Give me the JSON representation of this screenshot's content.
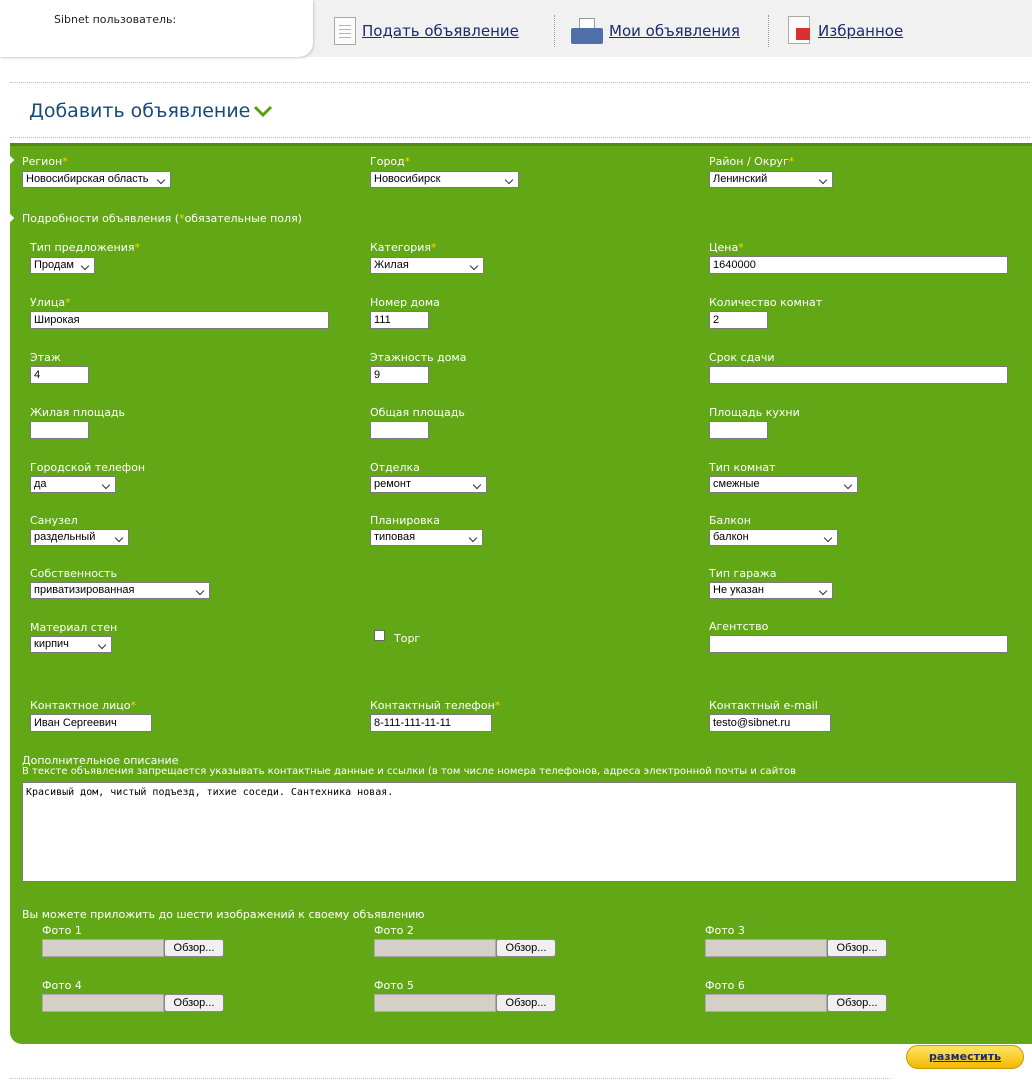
{
  "header": {
    "user_label": "Sibnet пользователь:",
    "nav": [
      {
        "label": "Подать объявление",
        "icon": "document-icon"
      },
      {
        "label": "Мои объявления",
        "icon": "inbox-icon"
      },
      {
        "label": "Избранное",
        "icon": "favorites-icon"
      }
    ]
  },
  "page_title": "Добавить объявление",
  "location": {
    "region_label": "Регион",
    "region_value": "Новосибирская область",
    "city_label": "Город",
    "city_value": "Новосибирск",
    "district_label": "Район / Округ",
    "district_value": "Ленинский"
  },
  "details_heading": {
    "pre": "Подробности объявления (",
    "star": "*",
    "post": "обязательные поля)"
  },
  "fields": {
    "offer_type_label": "Тип предложения",
    "offer_type_value": "Продам",
    "category_label": "Категория",
    "category_value": "Жилая",
    "price_label": "Цена",
    "price_value": "1640000",
    "street_label": "Улица",
    "street_value": "Широкая",
    "house_label": "Номер дома",
    "house_value": "111",
    "rooms_label": "Количество комнат",
    "rooms_value": "2",
    "floor_label": "Этаж",
    "floor_value": "4",
    "floors_label": "Этажность дома",
    "floors_value": "9",
    "deadline_label": "Срок сдачи",
    "deadline_value": "",
    "living_area_label": "Жилая площадь",
    "living_area_value": "",
    "total_area_label": "Общая площадь",
    "total_area_value": "",
    "kitchen_area_label": "Площадь кухни",
    "kitchen_area_value": "",
    "phone_line_label": "Городской телефон",
    "phone_line_value": "да",
    "finish_label": "Отделка",
    "finish_value": "ремонт",
    "room_type_label": "Тип комнат",
    "room_type_value": "смежные",
    "bath_label": "Санузел",
    "bath_value": "раздельный",
    "layout_label": "Планировка",
    "layout_value": "типовая",
    "balcony_label": "Балкон",
    "balcony_value": "балкон",
    "ownership_label": "Собственность",
    "ownership_value": "приватизированная",
    "garage_label": "Тип гаража",
    "garage_value": "Не указан",
    "walls_label": "Материал стен",
    "walls_value": "кирпич",
    "bargain_label": "Торг",
    "agency_label": "Агентство",
    "agency_value": ""
  },
  "contacts": {
    "person_label": "Контактное лицо",
    "person_value": "Иван Сергеевич",
    "phone_label": "Контактный телефон",
    "phone_value": "8-111-111-11-11",
    "email_label": "Контактный e-mail",
    "email_value": "testo@sibnet.ru"
  },
  "description": {
    "label": "Дополнительное описание",
    "note": "В тексте объявления запрещается указывать контактные данные и ссылки (в том числе номера телефонов, адреса электронной почты и сайтов",
    "value": "Красивый дом, чистый подъезд, тихие соседи. Сантехника новая."
  },
  "photos": {
    "heading": "Вы можете приложить до шести изображений к своему объявлению",
    "labels": [
      "Фото 1",
      "Фото 2",
      "Фото 3",
      "Фото 4",
      "Фото 5",
      "Фото 6"
    ],
    "browse_label": "Обзор..."
  },
  "submit_label": "разместить",
  "colors": {
    "panel": "#62a716",
    "required_star": "#ffd400",
    "title": "#19497a",
    "link": "#1a2c70"
  }
}
